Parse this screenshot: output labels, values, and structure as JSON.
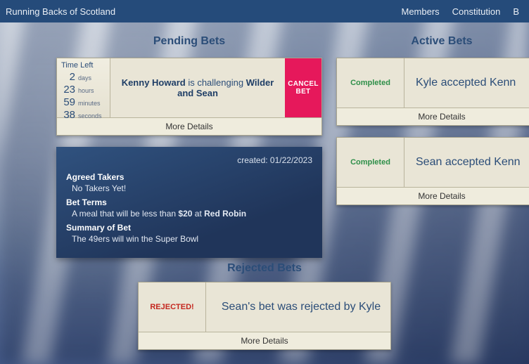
{
  "header": {
    "title": "Running Backs of Scotland",
    "nav": {
      "members": "Members",
      "constitution": "Constitution",
      "b": "B"
    }
  },
  "sections": {
    "pending_title": "Pending Bets",
    "active_title": "Active Bets",
    "rejected_title": "Rejected Bets"
  },
  "pending": {
    "time_left_label": "Time Left",
    "days_num": "2",
    "days_unit": "days",
    "hours_num": "23",
    "hours_unit": "hours",
    "minutes_num": "59",
    "minutes_unit": "minutes",
    "seconds_num": "38",
    "seconds_unit": "seconds",
    "challenger": "Kenny Howard",
    "challenge_mid": " is challenging ",
    "challengees": "Wilder and Sean",
    "cancel_label": "CANCEL BET",
    "more_label": "More Details",
    "details": {
      "created_label": "created: 01/22/2023",
      "agreed_takers_h": "Agreed Takers",
      "agreed_takers_v": "No Takers Yet!",
      "bet_terms_h": "Bet Terms",
      "bet_terms_pre": "A meal that will be less than ",
      "bet_terms_amount": "$20",
      "bet_terms_mid": " at ",
      "bet_terms_place": "Red Robin",
      "summary_h": "Summary of Bet",
      "summary_v": "The 49ers will win the Super Bowl"
    }
  },
  "active": {
    "item1": {
      "status": "Completed",
      "text": "Kyle accepted Kenn",
      "more": "More Details"
    },
    "item2": {
      "status": "Completed",
      "text": "Sean accepted Kenn",
      "more": "More Details"
    }
  },
  "rejected": {
    "item1": {
      "status": "REJECTED!",
      "text": "Sean's bet was rejected by Kyle",
      "more": "More Details"
    }
  }
}
